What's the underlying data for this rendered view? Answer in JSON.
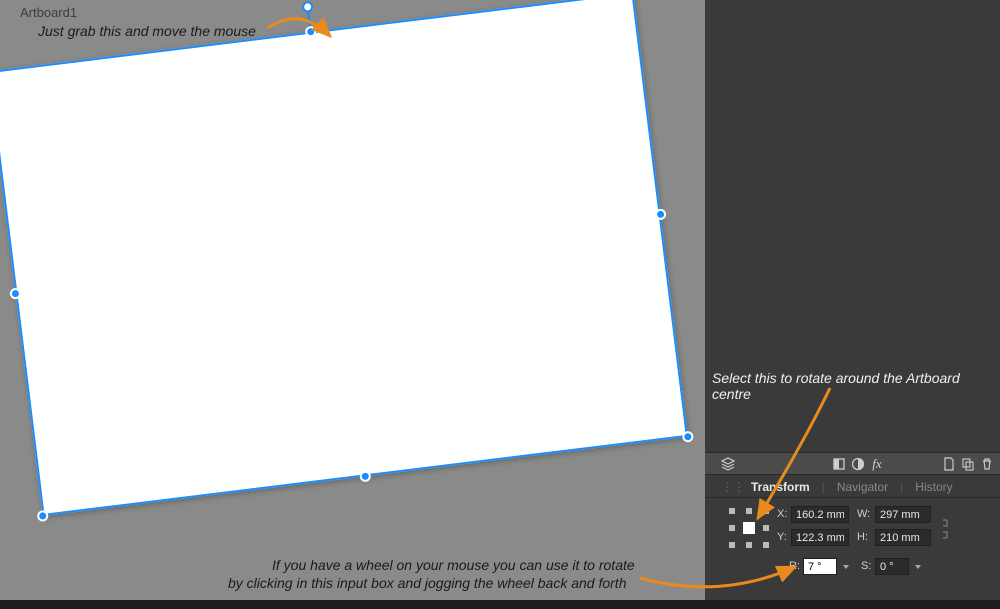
{
  "canvas": {
    "artboard_label": "Artboard1"
  },
  "annotations": {
    "grab_move": "Just grab this and move the mouse",
    "select_centre": "Select this to rotate around the Artboard centre",
    "wheel_line1": "If you have a wheel on your mouse you can use it to rotate",
    "wheel_line2": "by clicking in this input box and jogging the wheel back and forth"
  },
  "tabs": {
    "transform": "Transform",
    "navigator": "Navigator",
    "history": "History"
  },
  "transform": {
    "labels": {
      "x": "X:",
      "y": "Y:",
      "w": "W:",
      "h": "H:",
      "r": "R:",
      "s": "S:"
    },
    "x": "160.2 mm",
    "y": "122.3 mm",
    "w": "297 mm",
    "h": "210 mm",
    "r": "7 °",
    "s": "0 °"
  },
  "icons": {
    "layers": "layers",
    "square1": "square",
    "circle_half": "contrast",
    "fx": "fx",
    "doc": "doc",
    "copy": "copy",
    "trash": "trash"
  }
}
